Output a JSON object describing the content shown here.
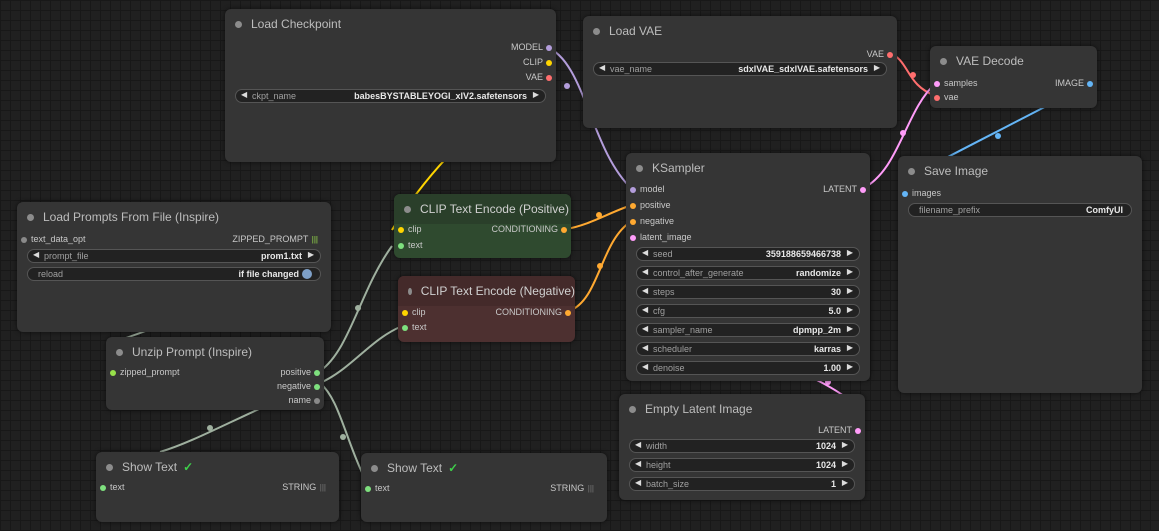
{
  "colors": {
    "model": "#b39ddb",
    "clip": "#ffd500",
    "vae": "#ff6e6e",
    "conditioning": "#ffa931",
    "latent": "#ff9cf9",
    "image": "#64b5f6",
    "string": "#7ee07e",
    "wire_gray": "#9fb09f",
    "positive_node": "#2f4a2f",
    "negative_node": "#4d3030"
  },
  "icons": {
    "node_dot": "dot-icon",
    "arrow_left": "triangle-left-icon",
    "arrow_right": "triangle-right-icon",
    "check": "check-icon",
    "grip": "grip-icon",
    "toggle": "toggle-icon"
  },
  "nodes": {
    "load_checkpoint": {
      "title": "Load Checkpoint",
      "outputs": [
        "MODEL",
        "CLIP",
        "VAE"
      ],
      "ckpt_name": {
        "name": "ckpt_name",
        "value": "babesBYSTABLEYOGI_xlV2.safetensors"
      }
    },
    "load_vae": {
      "title": "Load VAE",
      "output": "VAE",
      "vae_name": {
        "name": "vae_name",
        "value": "sdxlVAE_sdxlVAE.safetensors"
      }
    },
    "vae_decode": {
      "title": "VAE Decode",
      "inputs": [
        "samples",
        "vae"
      ],
      "output": "IMAGE"
    },
    "save_image": {
      "title": "Save Image",
      "input": "images",
      "filename_prefix": {
        "name": "filename_prefix",
        "value": "ComfyUI"
      }
    },
    "ksampler": {
      "title": "KSampler",
      "inputs": [
        "model",
        "positive",
        "negative",
        "latent_image"
      ],
      "output": "LATENT",
      "widgets": [
        {
          "name": "seed",
          "value": "359188659466738"
        },
        {
          "name": "control_after_generate",
          "value": "randomize"
        },
        {
          "name": "steps",
          "value": "30"
        },
        {
          "name": "cfg",
          "value": "5.0"
        },
        {
          "name": "sampler_name",
          "value": "dpmpp_2m"
        },
        {
          "name": "scheduler",
          "value": "karras"
        },
        {
          "name": "denoise",
          "value": "1.00"
        }
      ]
    },
    "clip_pos": {
      "title": "CLIP Text Encode (Positive)",
      "inputs": [
        "clip",
        "text"
      ],
      "output": "CONDITIONING"
    },
    "clip_neg": {
      "title": "CLIP Text Encode (Negative)",
      "inputs": [
        "clip",
        "text"
      ],
      "output": "CONDITIONING"
    },
    "load_prompts": {
      "title": "Load Prompts From File (Inspire)",
      "input": "text_data_opt",
      "output": "ZIPPED_PROMPT",
      "prompt_file": {
        "name": "prompt_file",
        "value": "prom1.txt"
      },
      "reload": {
        "name": "reload",
        "value": "if file changed"
      }
    },
    "unzip_prompt": {
      "title": "Unzip Prompt (Inspire)",
      "input": "zipped_prompt",
      "outputs": [
        "positive",
        "negative",
        "name"
      ]
    },
    "empty_latent": {
      "title": "Empty Latent Image",
      "output": "LATENT",
      "widgets": [
        {
          "name": "width",
          "value": "1024"
        },
        {
          "name": "height",
          "value": "1024"
        },
        {
          "name": "batch_size",
          "value": "1"
        }
      ]
    },
    "show_text_1": {
      "title": "Show Text",
      "input": "text",
      "output": "STRING"
    },
    "show_text_2": {
      "title": "Show Text",
      "input": "text",
      "output": "STRING"
    }
  }
}
